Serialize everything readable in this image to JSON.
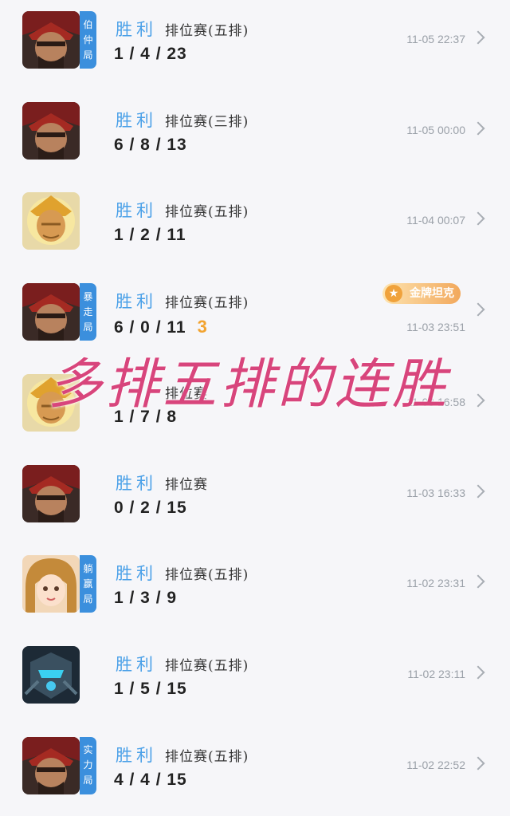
{
  "matches": [
    {
      "result": "胜利",
      "mode": "排位赛(五排)",
      "kda": "1/4/23",
      "time": "11-05 22:37",
      "tag": [
        "伯",
        "仲",
        "局"
      ],
      "hero": "hero-a"
    },
    {
      "result": "胜利",
      "mode": "排位赛(三排)",
      "kda": "6/8/13",
      "time": "11-05 00:00",
      "tag": null,
      "hero": "hero-a"
    },
    {
      "result": "胜利",
      "mode": "排位赛(五排)",
      "kda": "1/2/11",
      "time": "11-04 00:07",
      "tag": null,
      "hero": "hero-b"
    },
    {
      "result": "胜利",
      "mode": "排位赛(五排)",
      "kda": "6/0/11",
      "streak": "3",
      "badge": "金牌坦克",
      "time": "11-03 23:51",
      "tag": [
        "暴",
        "走",
        "局"
      ],
      "hero": "hero-a"
    },
    {
      "result": "",
      "mode": "排位赛",
      "kda": "1/7/8",
      "time": "11-03 16:58",
      "tag": null,
      "hero": "hero-b"
    },
    {
      "result": "胜利",
      "mode": "排位赛",
      "kda": "0/2/15",
      "time": "11-03 16:33",
      "tag": null,
      "hero": "hero-a"
    },
    {
      "result": "胜利",
      "mode": "排位赛(五排)",
      "kda": "1/3/9",
      "time": "11-02 23:31",
      "tag": [
        "躺",
        "赢",
        "局"
      ],
      "hero": "hero-c"
    },
    {
      "result": "胜利",
      "mode": "排位赛(五排)",
      "kda": "1/5/15",
      "time": "11-02 23:11",
      "tag": null,
      "hero": "hero-d"
    },
    {
      "result": "胜利",
      "mode": "排位赛(五排)",
      "kda": "4/4/15",
      "time": "11-02 22:52",
      "tag": [
        "实",
        "力",
        "局"
      ],
      "hero": "hero-a"
    }
  ],
  "overlay_text": "多排五排的连胜",
  "colors": {
    "result": "#4aa0e8",
    "tag": "#3b8fdd",
    "overlay": "#d8457c",
    "streak": "#f2a32f",
    "badge": "#f2a85c"
  }
}
